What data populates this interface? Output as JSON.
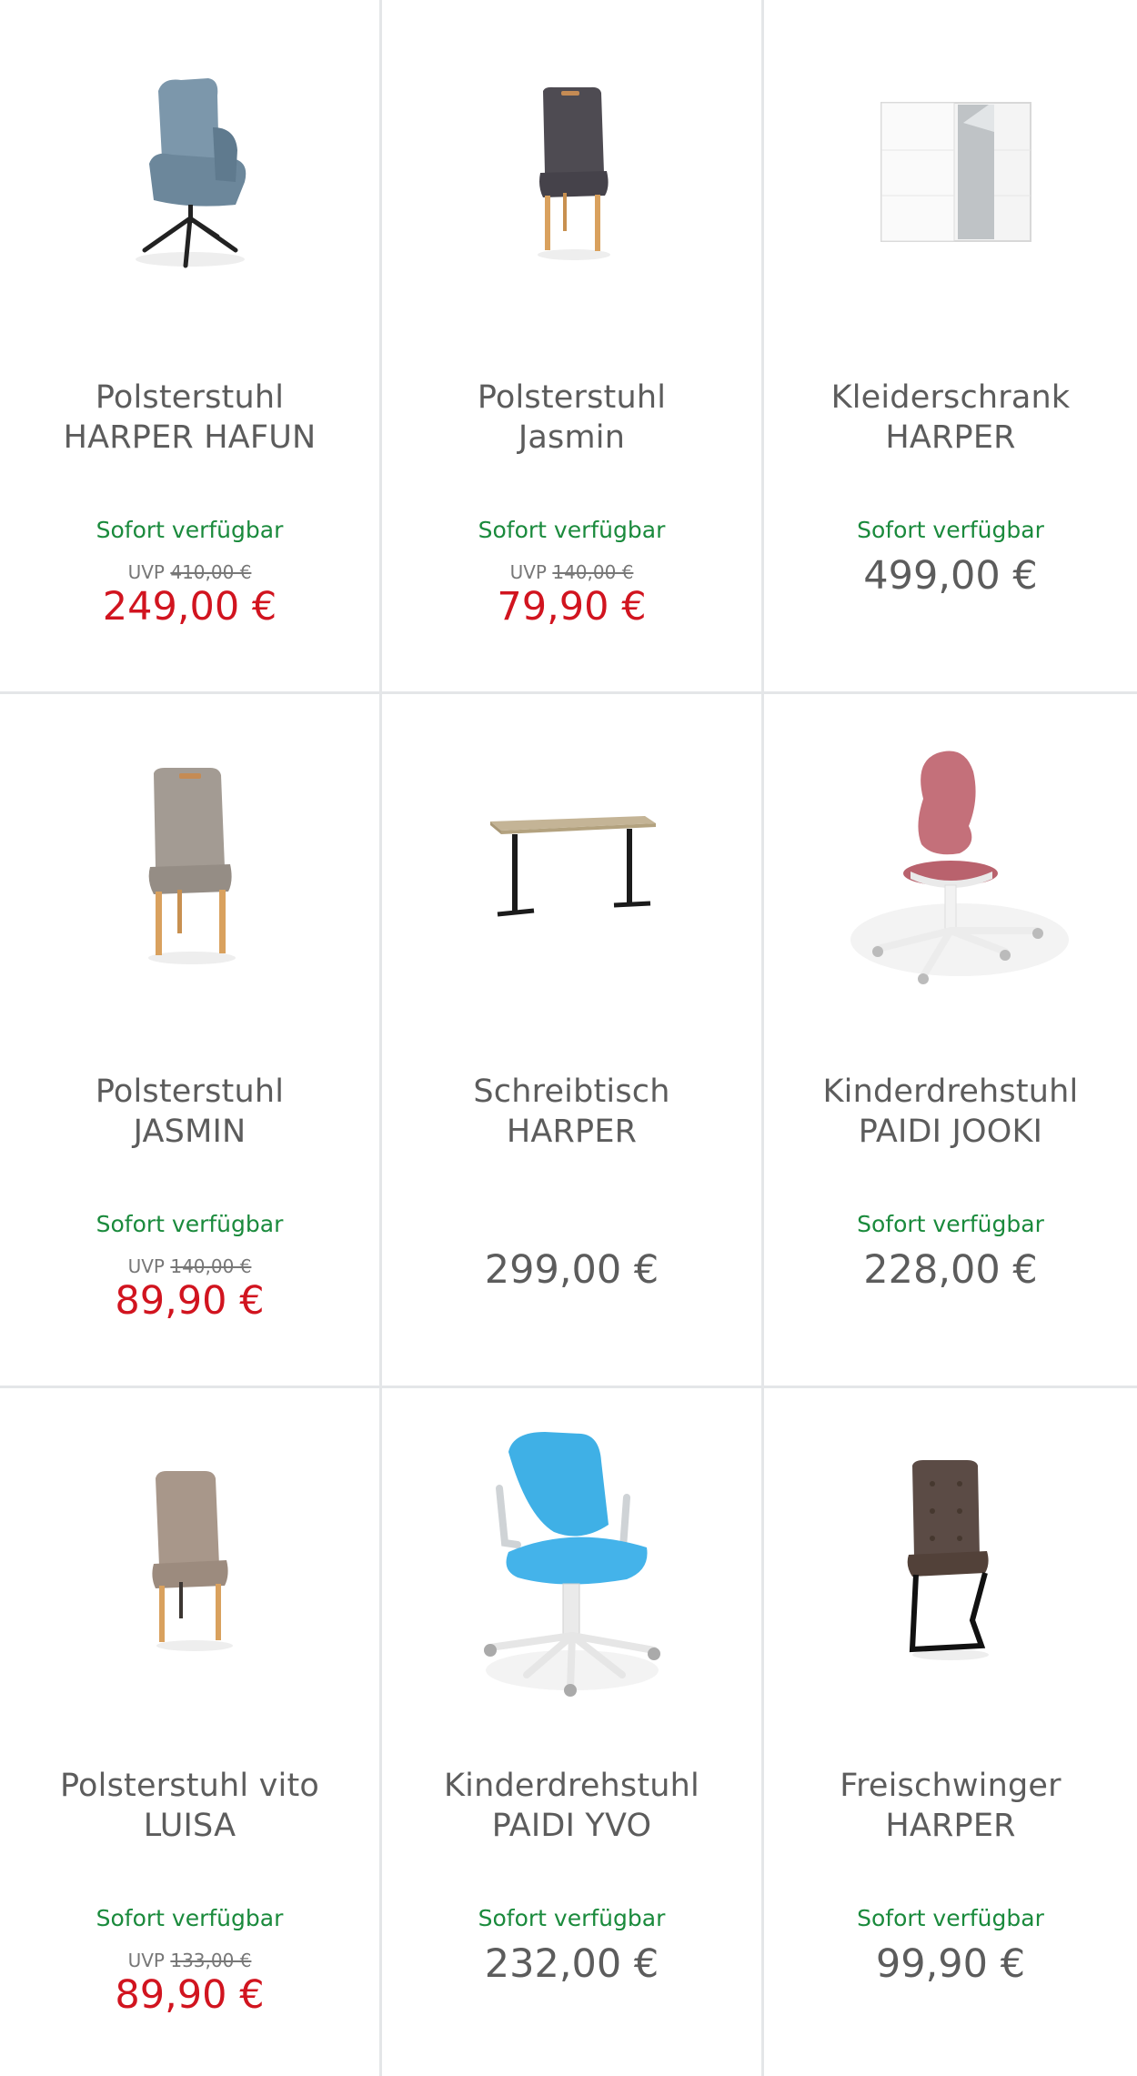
{
  "colors": {
    "available": "#1a8a3c",
    "sale_price": "#d1141f",
    "regular_price": "#5c5c5c",
    "divider": "#e4e6e8"
  },
  "products": [
    {
      "name_line1": "Polsterstuhl",
      "name_line2": "HARPER HAFUN",
      "availability": "Sofort verfügbar",
      "uvp_label": "UVP",
      "uvp_price": "410,00 €",
      "price": "249,00 €",
      "image_icon": "swivel-armchair-grey-icon"
    },
    {
      "name_line1": "Polsterstuhl",
      "name_line2": "Jasmin",
      "availability": "Sofort verfügbar",
      "uvp_label": "UVP",
      "uvp_price": "140,00 €",
      "price": "79,90 €",
      "image_icon": "dining-chair-anthracite-icon"
    },
    {
      "name_line1": "Kleiderschrank",
      "name_line2": "HARPER",
      "availability": "Sofort verfügbar",
      "price": "499,00 €",
      "image_icon": "wardrobe-white-mirror-icon"
    },
    {
      "name_line1": "Polsterstuhl",
      "name_line2": "JASMIN",
      "availability": "Sofort verfügbar",
      "uvp_label": "UVP",
      "uvp_price": "140,00 €",
      "price": "89,90 €",
      "image_icon": "dining-chair-taupe-icon"
    },
    {
      "name_line1": "Schreibtisch",
      "name_line2": "HARPER",
      "price": "299,00 €",
      "image_icon": "standing-desk-oak-icon"
    },
    {
      "name_line1": "Kinderdrehstuhl",
      "name_line2": "PAIDI JOOKI",
      "availability": "Sofort verfügbar",
      "price": "228,00 €",
      "image_icon": "kids-swivel-chair-pink-icon"
    },
    {
      "name_line1": "Polsterstuhl vito",
      "name_line2": "LUISA",
      "availability": "Sofort verfügbar",
      "uvp_label": "UVP",
      "uvp_price": "133,00 €",
      "price": "89,90 €",
      "image_icon": "dining-chair-beige-icon"
    },
    {
      "name_line1": "Kinderdrehstuhl",
      "name_line2": "PAIDI YVO",
      "availability": "Sofort verfügbar",
      "price": "232,00 €",
      "image_icon": "kids-swivel-chair-blue-icon"
    },
    {
      "name_line1": "Freischwinger",
      "name_line2": "HARPER",
      "availability": "Sofort verfügbar",
      "price": "99,90 €",
      "image_icon": "cantilever-chair-brown-icon"
    }
  ]
}
